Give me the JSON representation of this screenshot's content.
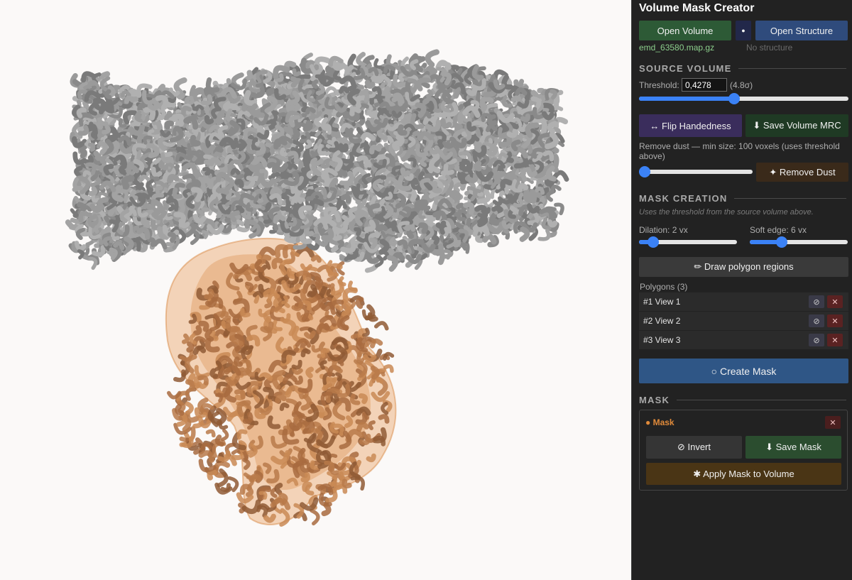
{
  "app": {
    "title": "Volume Mask Creator"
  },
  "files": {
    "open_volume_label": "Open Volume",
    "dot_label": "●",
    "open_structure_label": "Open Structure",
    "volume_file": "emd_63580.map.gz",
    "structure_file": "No structure"
  },
  "source_volume": {
    "heading": "SOURCE VOLUME",
    "threshold_label": "Threshold:",
    "threshold_value": "0,4278",
    "sigma_text": "(4.8σ)",
    "threshold_slider_fraction": 0.45,
    "flip_label": "↔ Flip Handedness",
    "save_volume_label": "⬇ Save Volume MRC",
    "dust_text": "Remove dust — min size: 100 voxels (uses threshold above)",
    "dust_slider_fraction": 0.0,
    "remove_dust_label": "✦ Remove Dust"
  },
  "mask_creation": {
    "heading": "MASK CREATION",
    "hint": "Uses the threshold from the source volume above.",
    "dilation_label": "Dilation: 2 vx",
    "dilation_fraction": 0.1,
    "soft_edge_label": "Soft edge: 6 vx",
    "soft_edge_fraction": 0.3,
    "draw_polygon_label": "✏ Draw polygon regions",
    "polygons_label": "Polygons (3)",
    "polygons": [
      {
        "label": "#1 View 1",
        "toggle_icon": "⊘",
        "delete_icon": "✕"
      },
      {
        "label": "#2 View 2",
        "toggle_icon": "⊘",
        "delete_icon": "✕"
      },
      {
        "label": "#3 View 3",
        "toggle_icon": "⊘",
        "delete_icon": "✕"
      }
    ],
    "create_mask_label": "○ Create Mask"
  },
  "mask": {
    "heading": "MASK",
    "name": "● Mask",
    "close_icon": "✕",
    "invert_label": "⊘ Invert",
    "save_mask_label": "⬇ Save Mask",
    "apply_label": "✱ Apply Mask to Volume"
  },
  "colors": {
    "volume_gray": "#8e8e8e",
    "mask_orange": "#e49a5a",
    "accent_blue": "#3b82f6",
    "green_button": "#2d5a36",
    "blue_button": "#2f4b7c",
    "purple_button": "#3a2d5c"
  },
  "viewport": {
    "content": "3D density map rendering with orange mask overlay"
  }
}
